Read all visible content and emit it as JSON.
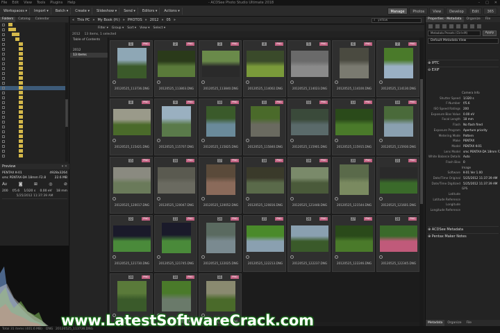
{
  "titlebar": {
    "menus": [
      "File",
      "Edit",
      "View",
      "Tools",
      "Plugins",
      "Help"
    ],
    "app_title": "- ACDSee Photo Studio Ultimate 2018",
    "win": [
      "–",
      "□",
      "✕"
    ]
  },
  "toolbar": {
    "items": [
      "Workspaces ▾",
      "Import ▾",
      "Batch ▾",
      "Create ▾",
      "Slideshow ▾",
      "Send ▾",
      "Editors ▾",
      "Actions ▾"
    ],
    "modes": [
      "Manage",
      "Photos",
      "View",
      "Develop",
      "Edit",
      "365"
    ],
    "active_mode": "Manage"
  },
  "left_panel": {
    "tabs": [
      "Folders",
      "Catalog",
      "Calendar"
    ],
    "active_tab": "Folders"
  },
  "path": {
    "crumbs": [
      "«",
      "This PC",
      "»",
      "My Book (H:)",
      "»",
      "PHOTOS",
      "»",
      "2012",
      "»",
      "05",
      "»"
    ],
    "search_placeholder": "yellow"
  },
  "filters": [
    "Filter ▾",
    "Group ▾",
    "Sort ▾",
    "View ▾",
    "Select ▾"
  ],
  "count_bar": [
    "2012",
    "13 items, 1 selected"
  ],
  "toc": {
    "title": "Table of Contents",
    "rows": [
      "2012",
      "13 items"
    ]
  },
  "thumbnails": [
    {
      "n": "1",
      "name": "20120525_113736.DNG",
      "badge": "PNG",
      "c": [
        "#3b5a2a",
        "#8ea7b5"
      ]
    },
    {
      "n": "2",
      "name": "20120525_113803.DNG",
      "badge": "PNG",
      "c": [
        "#5a7a3a",
        "#2a3a1a"
      ]
    },
    {
      "n": "3",
      "name": "20120525_113840.DNG",
      "badge": "PNG",
      "c": [
        "#2a2a2a",
        "#6a8a4a"
      ]
    },
    {
      "n": "4",
      "name": "20120525_114002.DNG",
      "badge": "PNG",
      "c": [
        "#7a9a3a",
        "#3a4a2a"
      ]
    },
    {
      "n": "5",
      "name": "20120525_114023.DNG",
      "badge": "PNG",
      "c": [
        "#8a8a8a",
        "#6a6a6a"
      ]
    },
    {
      "n": "6",
      "name": "20120525_114100.DNG",
      "badge": "PNG",
      "c": [
        "#7a7a70",
        "#4a4a40"
      ]
    },
    {
      "n": "7",
      "name": "20120525_114130.DNG",
      "badge": "PNG",
      "c": [
        "#9ab0c4",
        "#4a7a2a"
      ]
    },
    {
      "n": "8",
      "name": "20120525_115421.DNG",
      "badge": "PNG",
      "c": [
        "#4a6a2a",
        "#9a9a8a"
      ]
    },
    {
      "n": "9",
      "name": "20120525_115707.DNG",
      "badge": "PNG",
      "c": [
        "#5a7a4a",
        "#9ab0c0"
      ]
    },
    {
      "n": "10",
      "name": "20120525_115825.DNG",
      "badge": "PNG",
      "c": [
        "#6a8a9a",
        "#3a5a2a"
      ]
    },
    {
      "n": "11",
      "name": "20120525_115840.DNG",
      "badge": "PNG",
      "c": [
        "#6a6a60",
        "#4a6a2a"
      ]
    },
    {
      "n": "12",
      "name": "20120525_115901.DNG",
      "badge": "PNG",
      "c": [
        "#5a6a6a",
        "#3a4a3a"
      ]
    },
    {
      "n": "13",
      "name": "20120525_115915.DNG",
      "badge": "PNG",
      "c": [
        "#4a7a2a",
        "#2a4a1a"
      ]
    },
    {
      "n": "14",
      "name": "20120525_115930.DNG",
      "badge": "PNG",
      "c": [
        "#8aa0b0",
        "#4a6a3a"
      ]
    },
    {
      "n": "15",
      "name": "20120525_120017.DNG",
      "badge": "PNG",
      "c": [
        "#6a7a5a",
        "#8a8a80"
      ]
    },
    {
      "n": "16",
      "name": "20120525_120047.DNG",
      "badge": "PNG",
      "c": [
        "#6a6a60",
        "#5a5a50"
      ]
    },
    {
      "n": "17",
      "name": "20120525_120052.DNG",
      "badge": "PNG",
      "c": [
        "#8a6a5a",
        "#5a4a3a"
      ]
    },
    {
      "n": "18",
      "name": "20120525_120816.DNG",
      "badge": "PNG",
      "c": [
        "#5a6a4a",
        "#3a3a2a"
      ]
    },
    {
      "n": "19",
      "name": "20120525_121448.DNG",
      "badge": "PNG",
      "c": [
        "#4a5a3a",
        "#7a8a6a"
      ]
    },
    {
      "n": "20",
      "name": "20120525_121544.DNG",
      "badge": "PNG",
      "c": [
        "#7a8a60",
        "#5a6a4a"
      ]
    },
    {
      "n": "21",
      "name": "20120525_121601.DNG",
      "badge": "PNG",
      "c": [
        "#3a6a2a",
        "#2a2a2a"
      ]
    },
    {
      "n": "22",
      "name": "20120525_121730.DNG",
      "badge": "PNG",
      "c": [
        "#4a8a3a",
        "#1a1a2a"
      ]
    },
    {
      "n": "23",
      "name": "20120525_121745.DNG",
      "badge": "PNG",
      "c": [
        "#4a8a3a",
        "#1a1a2a"
      ]
    },
    {
      "n": "24",
      "name": "20120525_122025.DNG",
      "badge": "PNG",
      "c": [
        "#7a8a90",
        "#5a6a60"
      ]
    },
    {
      "n": "25",
      "name": "20120525_122213.DNG",
      "badge": "PNG",
      "c": [
        "#8aa0b0",
        "#4a8a2a"
      ]
    },
    {
      "n": "26",
      "name": "20120525_122237.DNG",
      "badge": "PNG",
      "c": [
        "#3a5a2a",
        "#8aa0b0"
      ]
    },
    {
      "n": "27",
      "name": "20120525_122246.DNG",
      "badge": "PNG",
      "c": [
        "#4a7a2a",
        "#2a4a1a"
      ]
    },
    {
      "n": "28",
      "name": "20120525_122345.DNG",
      "badge": "PNG",
      "c": [
        "#c05a7a",
        "#3a6a2a"
      ]
    },
    {
      "n": "29",
      "name": "20120525_122418.DNG",
      "badge": "PNG",
      "c": [
        "#3a5a2a",
        "#5a7a3a"
      ]
    },
    {
      "n": "30",
      "name": "20120525_122450.DNG",
      "badge": "PNG",
      "c": [
        "#6a7a6a",
        "#4a7a2a"
      ]
    },
    {
      "n": "31",
      "name": "20120525_122519.DNG",
      "badge": "PNG",
      "c": [
        "#4a6a2a",
        "#8a8a70"
      ]
    }
  ],
  "right_panel": {
    "tabs": [
      "Properties - Metadata",
      "Organize",
      "File"
    ],
    "active_tab": "Properties - Metadata",
    "preset": "Metadata Presets (Ctrl+M)",
    "apply": "Apply",
    "view": "Default Metadata View",
    "sections": [
      "IPTC",
      "EXIF",
      "ACDSee Metadata",
      "Pentax Maker Notes"
    ],
    "exif": [
      {
        "label": "",
        "value": "Camera Info"
      },
      {
        "label": "Shutter Speed",
        "value": "1/320 s"
      },
      {
        "label": "F-Number",
        "value": "f/5.6"
      },
      {
        "label": "ISO Speed Ratings",
        "value": "200"
      },
      {
        "label": "Exposure Bias Value",
        "value": "0.00 eV"
      },
      {
        "label": "Focal Length",
        "value": "18 mm"
      },
      {
        "label": "Flash",
        "value": "No flash fired"
      },
      {
        "label": "Exposure Program",
        "value": "Aperture priority"
      },
      {
        "label": "Metering Mode",
        "value": "Pattern"
      },
      {
        "label": "Make",
        "value": "PENTAX"
      },
      {
        "label": "Model",
        "value": "PENTAX K-01"
      },
      {
        "label": "Lens Model",
        "value": "smc PENTAX-DA 18mm F2.8"
      },
      {
        "label": "White Balance Details",
        "value": "Auto"
      },
      {
        "label": "Flash Bias",
        "value": "0"
      },
      {
        "label": "",
        "value": "Image"
      },
      {
        "label": "Software",
        "value": "K-01 Ver 1.00"
      },
      {
        "label": "Date/Time Original",
        "value": "5/25/2012 11:37:39 AM"
      },
      {
        "label": "Date/Time Digitized",
        "value": "5/25/2012 11:37:39 AM"
      },
      {
        "label": "",
        "value": "GPS"
      },
      {
        "label": "Latitude",
        "value": ""
      },
      {
        "label": "Latitude Reference",
        "value": ""
      },
      {
        "label": "Longitude",
        "value": ""
      },
      {
        "label": "Longitude Reference",
        "value": ""
      }
    ],
    "bottom_tabs": [
      "Metadata",
      "Organize",
      "File"
    ]
  },
  "preview": {
    "title": "Preview",
    "camera": "PENTAX K-01",
    "size": "4928x3264",
    "lens": "smc PENTAX-DA 18mm F2.8",
    "filesize": "22.6 MB",
    "aperture": "f/5.6",
    "shutter": "1/320 s",
    "ev": "0.00 eV",
    "focal": "18 mm",
    "iso": "200",
    "date": "5/25/2012 11:37:39 AM"
  },
  "status": {
    "left": "Total 31 items (401.6 MB)",
    "type": "DNG",
    "file": "20120525_113736.DNG"
  },
  "watermark": "www.LatestSoftwareCrack.com"
}
